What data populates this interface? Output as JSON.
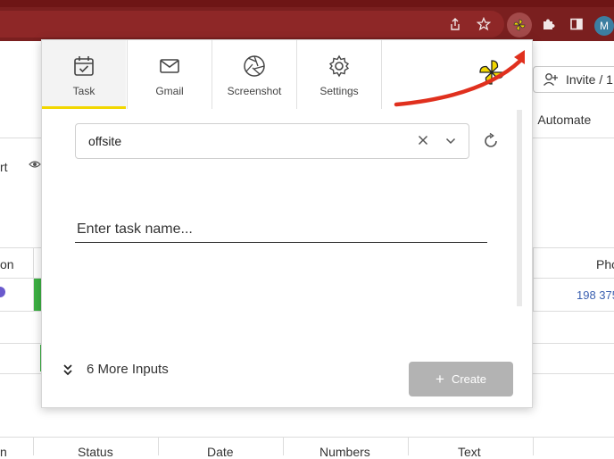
{
  "browser": {
    "profile_initial": "M"
  },
  "background": {
    "invite_label": "Invite / 1",
    "automate_label": "Automate",
    "left_partial_1": "rt",
    "left_partial_2": "on",
    "left_partial_3": "n",
    "right_header_partial": "Pho",
    "right_cell_partial": "198 375",
    "table_headers": [
      "Status",
      "Date",
      "Numbers",
      "Text"
    ]
  },
  "popup": {
    "tabs": [
      {
        "label": "Task",
        "icon": "calendar-check-icon",
        "active": true
      },
      {
        "label": "Gmail",
        "icon": "mail-icon",
        "active": false
      },
      {
        "label": "Screenshot",
        "icon": "camera-aperture-icon",
        "active": false
      },
      {
        "label": "Settings",
        "icon": "gear-icon",
        "active": false
      }
    ],
    "select_value": "offsite",
    "task_placeholder": "Enter task name...",
    "more_inputs_label": "6 More Inputs",
    "create_label": "Create"
  },
  "colors": {
    "accent_yellow": "#f2d700",
    "chrome_red": "#7a1f1f",
    "arrow_red": "#e0301e",
    "create_disabled": "#b3b3b3",
    "status_green": "#3cb043",
    "link_blue": "#3a5fb0"
  }
}
